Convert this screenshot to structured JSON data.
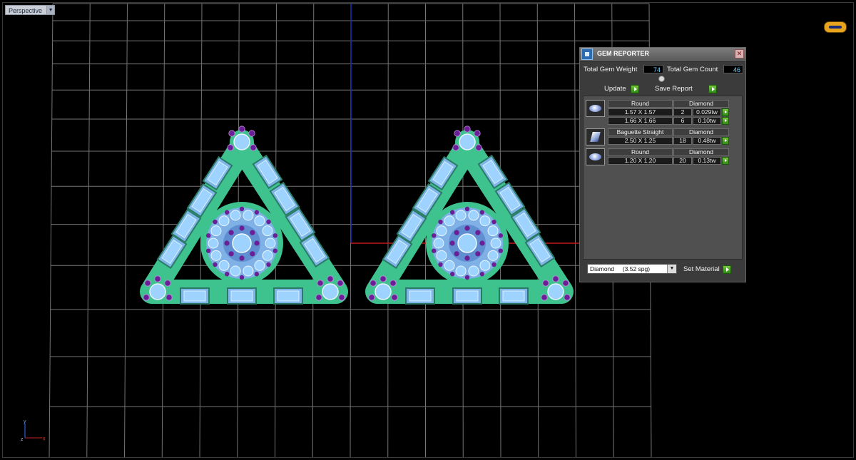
{
  "viewport": {
    "label": "Perspective",
    "dropdown_glyph": "▼",
    "background": "#000000",
    "grid_color": "#8a8a8a",
    "axis_vertical_color": "#1c2fb0",
    "axis_horizontal_color": "#c01818",
    "axes_labels": {
      "y": "y",
      "z": "z",
      "x": "x"
    },
    "logo_icon": "brand-logo-icon"
  },
  "model": {
    "metal_color": "#3ec38f",
    "stone_color": "#9fd3ff",
    "accent_color": "#6a1f96"
  },
  "gem_reporter": {
    "title": "GEM REPORTER",
    "close_glyph": "✕",
    "total_weight_label": "Total Gem Weight",
    "total_weight_value": "74",
    "total_count_label": "Total Gem Count",
    "total_count_value": "46",
    "update_label": "Update",
    "save_report_label": "Save Report",
    "groups": [
      {
        "icon": "round-gem-icon",
        "shape": "Round",
        "material": "Diamond",
        "rows": [
          {
            "size": "1.57 X 1.57",
            "count": "2",
            "weight": "0.029tw"
          },
          {
            "size": "1.66 X 1.66",
            "count": "6",
            "weight": "0.10tw"
          }
        ]
      },
      {
        "icon": "baguette-gem-icon",
        "shape": "Baguette Straight",
        "material": "Diamond",
        "rows": [
          {
            "size": "2.50 X 1.25",
            "count": "18",
            "weight": "0.48tw"
          }
        ]
      },
      {
        "icon": "round-gem-icon",
        "shape": "Round",
        "material": "Diamond",
        "rows": [
          {
            "size": "1.20 X 1.20",
            "count": "20",
            "weight": "0.13tw"
          }
        ]
      }
    ],
    "material_select_value": "Diamond     (3.52 spg)",
    "set_material_label": "Set Material"
  }
}
